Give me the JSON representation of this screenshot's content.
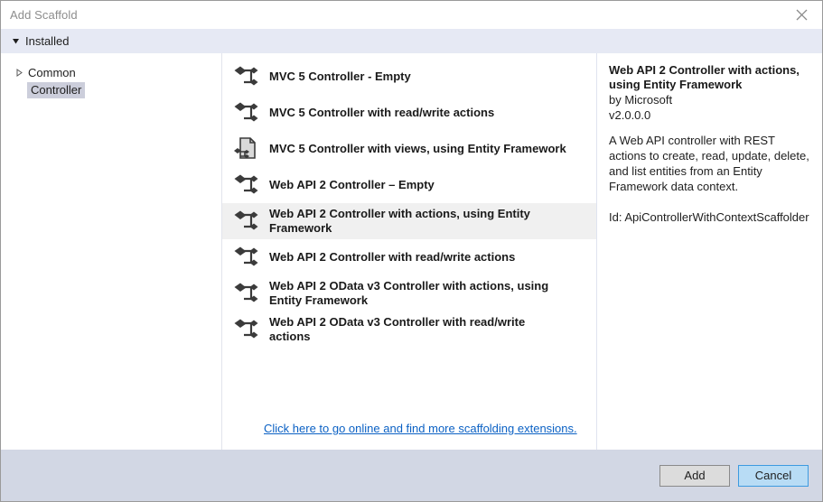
{
  "window": {
    "title": "Add Scaffold",
    "close_icon": "close-icon"
  },
  "installed_band": {
    "label": "Installed",
    "expander_icon": "triangle-down-icon"
  },
  "tree": {
    "items": [
      {
        "label": "Common",
        "expander_icon": "triangle-right-icon",
        "selected": false,
        "level": 0
      },
      {
        "label": "Controller",
        "expander_icon": "",
        "selected": true,
        "level": 1
      }
    ]
  },
  "list": {
    "items": [
      {
        "label": "MVC 5 Controller - Empty",
        "icon": "scaffold-branch-icon",
        "selected": false
      },
      {
        "label": "MVC 5 Controller with read/write actions",
        "icon": "scaffold-branch-icon",
        "selected": false
      },
      {
        "label": "MVC 5 Controller with views, using Entity Framework",
        "icon": "scaffold-document-branch-icon",
        "selected": false
      },
      {
        "label": "Web API 2 Controller – Empty",
        "icon": "scaffold-branch-icon",
        "selected": false
      },
      {
        "label": "Web API 2 Controller with actions, using Entity Framework",
        "icon": "scaffold-branch-icon",
        "selected": true
      },
      {
        "label": "Web API 2 Controller with read/write actions",
        "icon": "scaffold-branch-icon",
        "selected": false
      },
      {
        "label": "Web API 2 OData v3 Controller with actions, using Entity Framework",
        "icon": "scaffold-branch-icon",
        "selected": false
      },
      {
        "label": "Web API 2 OData v3 Controller with read/write actions",
        "icon": "scaffold-branch-icon",
        "selected": false
      }
    ],
    "more_link": "Click here to go online and find more scaffolding extensions."
  },
  "info": {
    "title": "Web API 2 Controller with actions, using Entity Framework",
    "author": "by Microsoft",
    "version": "v2.0.0.0",
    "description": "A Web API controller with REST actions to create, read, update, delete, and list entities from an Entity Framework data context.",
    "id": "Id: ApiControllerWithContextScaffolder"
  },
  "footer": {
    "add_label": "Add",
    "cancel_label": "Cancel"
  },
  "colors": {
    "link": "#0b61c4",
    "selection_grey": "#cccedb",
    "row_selected": "#f0f0f0",
    "footer_bg": "#d2d7e4",
    "band_bg": "#e6e9f4",
    "cancel_bg": "#b8dcf5",
    "cancel_border": "#3d9ae0",
    "add_bg": "#dcdcdc"
  }
}
